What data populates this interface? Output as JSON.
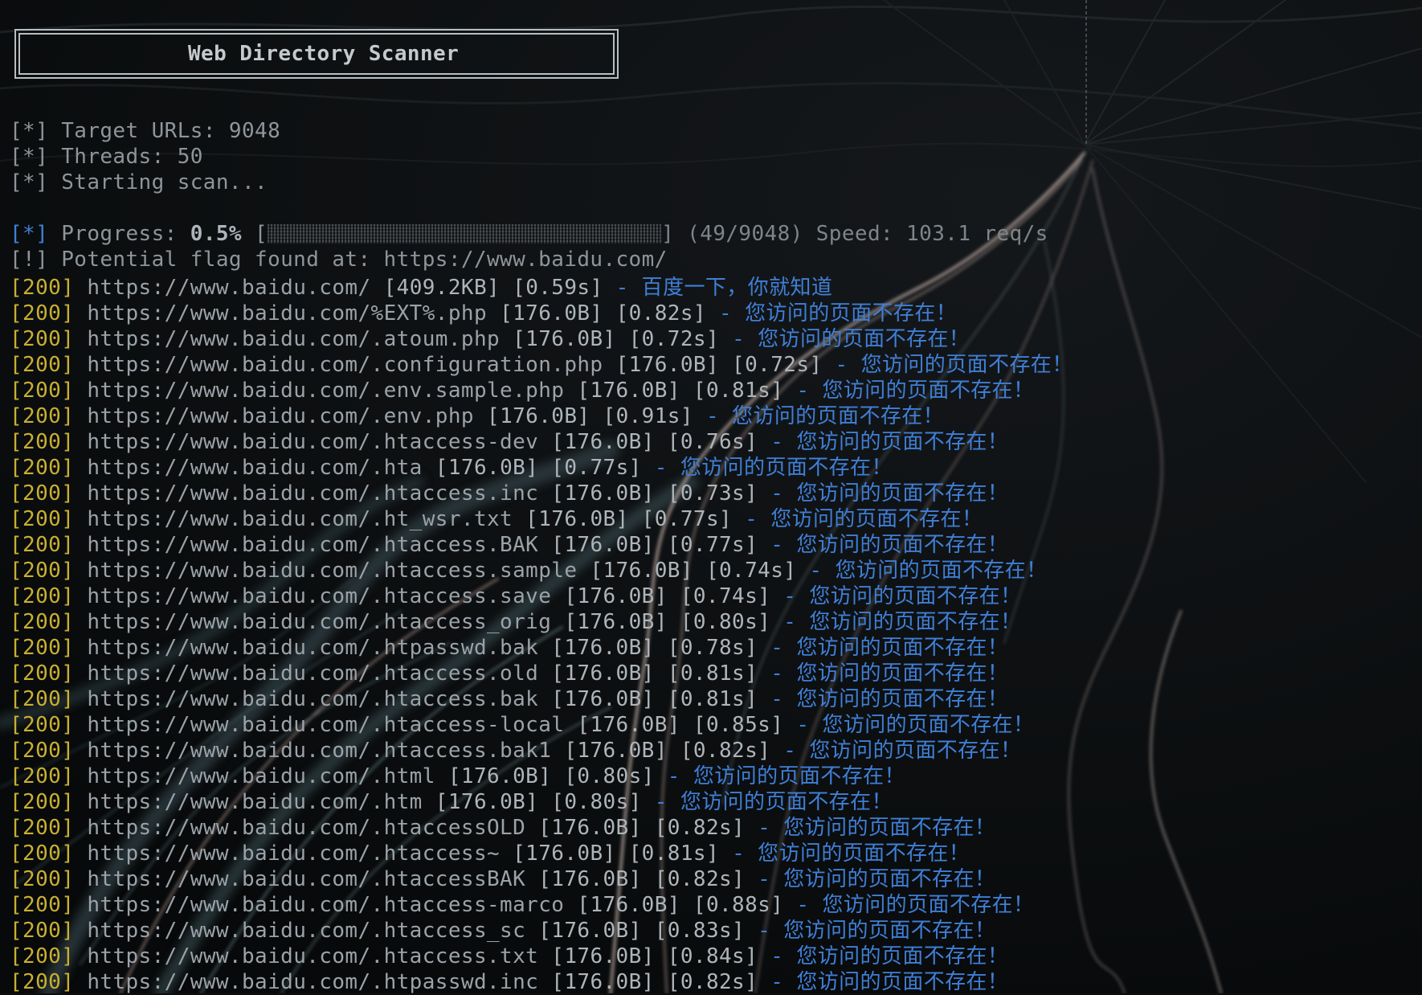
{
  "banner": {
    "title": "Web Directory Scanner"
  },
  "info": [
    "[*] Target URLs: 9048",
    "[*] Threads: 50",
    "[*] Starting scan..."
  ],
  "progress": {
    "tag": "[*]",
    "label": " Progress: ",
    "percent_text": "0.5%",
    "bar_open": " [",
    "bar_close": "]",
    "fraction": 0.005,
    "rest": " (49/9048) Speed: 103.1 req/s"
  },
  "flag_line": "[!] Potential flag found at: https://www.baidu.com/",
  "results": [
    {
      "code": "[200]",
      "url": "https://www.baidu.com/",
      "size": "[409.2KB]",
      "time": "[0.59s]",
      "title": "- 百度一下，你就知道"
    },
    {
      "code": "[200]",
      "url": "https://www.baidu.com/%EXT%.php",
      "size": "[176.0B]",
      "time": "[0.82s]",
      "title": "- 您访问的页面不存在！"
    },
    {
      "code": "[200]",
      "url": "https://www.baidu.com/.atoum.php",
      "size": "[176.0B]",
      "time": "[0.72s]",
      "title": "- 您访问的页面不存在！"
    },
    {
      "code": "[200]",
      "url": "https://www.baidu.com/.configuration.php",
      "size": "[176.0B]",
      "time": "[0.72s]",
      "title": "- 您访问的页面不存在！"
    },
    {
      "code": "[200]",
      "url": "https://www.baidu.com/.env.sample.php",
      "size": "[176.0B]",
      "time": "[0.81s]",
      "title": "- 您访问的页面不存在！"
    },
    {
      "code": "[200]",
      "url": "https://www.baidu.com/.env.php",
      "size": "[176.0B]",
      "time": "[0.91s]",
      "title": "- 您访问的页面不存在！"
    },
    {
      "code": "[200]",
      "url": "https://www.baidu.com/.htaccess-dev",
      "size": "[176.0B]",
      "time": "[0.76s]",
      "title": "- 您访问的页面不存在！"
    },
    {
      "code": "[200]",
      "url": "https://www.baidu.com/.hta",
      "size": "[176.0B]",
      "time": "[0.77s]",
      "title": "- 您访问的页面不存在！"
    },
    {
      "code": "[200]",
      "url": "https://www.baidu.com/.htaccess.inc",
      "size": "[176.0B]",
      "time": "[0.73s]",
      "title": "- 您访问的页面不存在！"
    },
    {
      "code": "[200]",
      "url": "https://www.baidu.com/.ht_wsr.txt",
      "size": "[176.0B]",
      "time": "[0.77s]",
      "title": "- 您访问的页面不存在！"
    },
    {
      "code": "[200]",
      "url": "https://www.baidu.com/.htaccess.BAK",
      "size": "[176.0B]",
      "time": "[0.77s]",
      "title": "- 您访问的页面不存在！"
    },
    {
      "code": "[200]",
      "url": "https://www.baidu.com/.htaccess.sample",
      "size": "[176.0B]",
      "time": "[0.74s]",
      "title": "- 您访问的页面不存在！"
    },
    {
      "code": "[200]",
      "url": "https://www.baidu.com/.htaccess.save",
      "size": "[176.0B]",
      "time": "[0.74s]",
      "title": "- 您访问的页面不存在！"
    },
    {
      "code": "[200]",
      "url": "https://www.baidu.com/.htaccess_orig",
      "size": "[176.0B]",
      "time": "[0.80s]",
      "title": "- 您访问的页面不存在！"
    },
    {
      "code": "[200]",
      "url": "https://www.baidu.com/.htpasswd.bak",
      "size": "[176.0B]",
      "time": "[0.78s]",
      "title": "- 您访问的页面不存在！"
    },
    {
      "code": "[200]",
      "url": "https://www.baidu.com/.htaccess.old",
      "size": "[176.0B]",
      "time": "[0.81s]",
      "title": "- 您访问的页面不存在！"
    },
    {
      "code": "[200]",
      "url": "https://www.baidu.com/.htaccess.bak",
      "size": "[176.0B]",
      "time": "[0.81s]",
      "title": "- 您访问的页面不存在！"
    },
    {
      "code": "[200]",
      "url": "https://www.baidu.com/.htaccess-local",
      "size": "[176.0B]",
      "time": "[0.85s]",
      "title": "- 您访问的页面不存在！"
    },
    {
      "code": "[200]",
      "url": "https://www.baidu.com/.htaccess.bak1",
      "size": "[176.0B]",
      "time": "[0.82s]",
      "title": "- 您访问的页面不存在！"
    },
    {
      "code": "[200]",
      "url": "https://www.baidu.com/.html",
      "size": "[176.0B]",
      "time": "[0.80s]",
      "title": "- 您访问的页面不存在！"
    },
    {
      "code": "[200]",
      "url": "https://www.baidu.com/.htm",
      "size": "[176.0B]",
      "time": "[0.80s]",
      "title": "- 您访问的页面不存在！"
    },
    {
      "code": "[200]",
      "url": "https://www.baidu.com/.htaccessOLD",
      "size": "[176.0B]",
      "time": "[0.82s]",
      "title": "- 您访问的页面不存在！"
    },
    {
      "code": "[200]",
      "url": "https://www.baidu.com/.htaccess~",
      "size": "[176.0B]",
      "time": "[0.81s]",
      "title": "- 您访问的页面不存在！"
    },
    {
      "code": "[200]",
      "url": "https://www.baidu.com/.htaccessBAK",
      "size": "[176.0B]",
      "time": "[0.82s]",
      "title": "- 您访问的页面不存在！"
    },
    {
      "code": "[200]",
      "url": "https://www.baidu.com/.htaccess-marco",
      "size": "[176.0B]",
      "time": "[0.88s]",
      "title": "- 您访问的页面不存在！"
    },
    {
      "code": "[200]",
      "url": "https://www.baidu.com/.htaccess_sc",
      "size": "[176.0B]",
      "time": "[0.83s]",
      "title": "- 您访问的页面不存在！"
    },
    {
      "code": "[200]",
      "url": "https://www.baidu.com/.htaccess.txt",
      "size": "[176.0B]",
      "time": "[0.84s]",
      "title": "- 您访问的页面不存在！"
    },
    {
      "code": "[200]",
      "url": "https://www.baidu.com/.htpasswd.inc",
      "size": "[176.0B]",
      "time": "[0.82s]",
      "title": "- 您访问的页面不存在！"
    }
  ],
  "colors": {
    "background": "#0c0e10",
    "status_code": "#c9b030",
    "page_title": "#3f7fd6",
    "text": "#9ba2a8"
  }
}
